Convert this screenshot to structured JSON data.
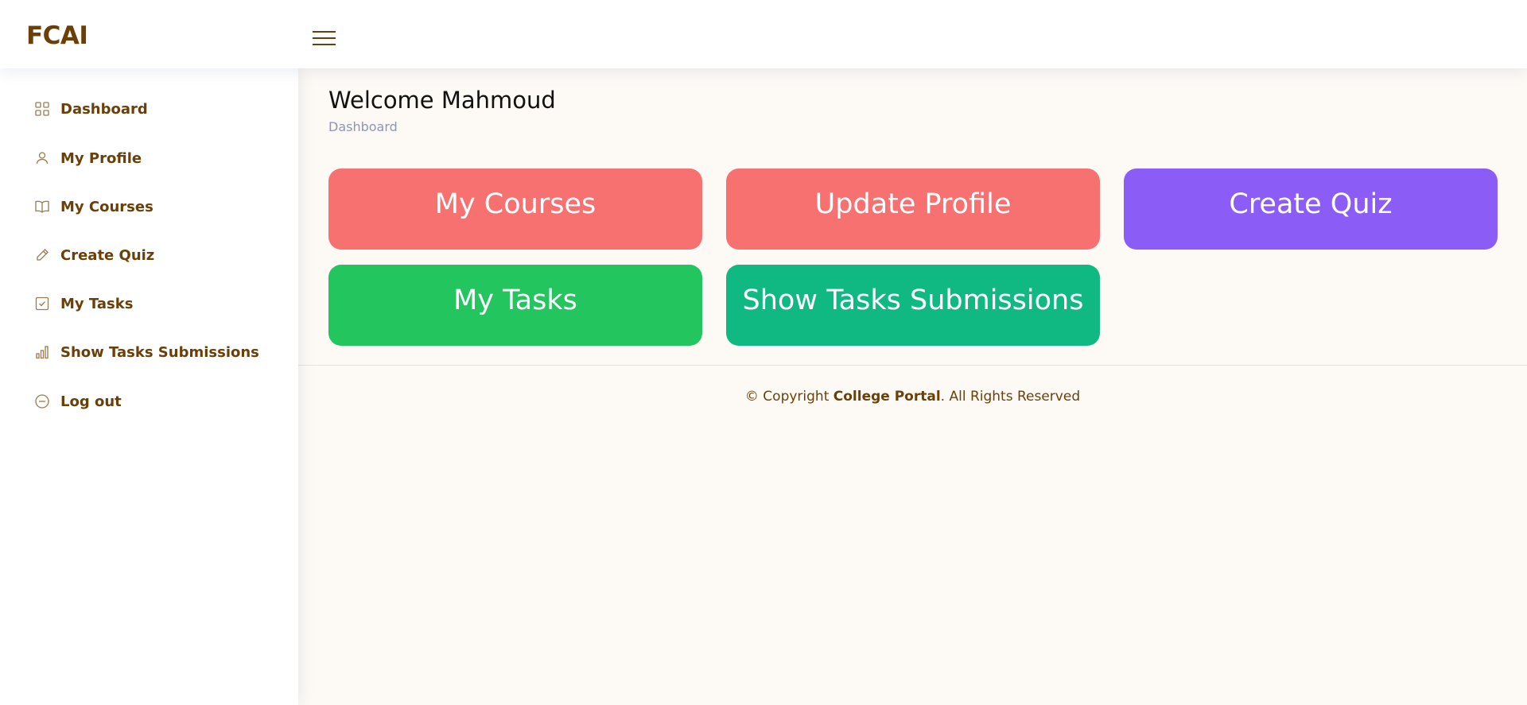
{
  "header": {
    "logo": "FCAI",
    "menu_icon": "hamburger-menu-icon"
  },
  "sidebar": {
    "items": [
      {
        "label": "Dashboard",
        "icon": "grid-icon"
      },
      {
        "label": "My Profile",
        "icon": "person-icon"
      },
      {
        "label": "My Courses",
        "icon": "book-icon"
      },
      {
        "label": "Create Quiz",
        "icon": "pencil-icon"
      },
      {
        "label": "My Tasks",
        "icon": "check-square-icon"
      },
      {
        "label": "Show Tasks Submissions",
        "icon": "bar-chart-icon"
      },
      {
        "label": "Log out",
        "icon": "minus-circle-icon"
      }
    ]
  },
  "main": {
    "title": "Welcome Mahmoud",
    "breadcrumb": "Dashboard",
    "tiles": [
      {
        "label": "My Courses",
        "color": "#f87171"
      },
      {
        "label": "Update Profile",
        "color": "#f87171"
      },
      {
        "label": "Create Quiz",
        "color": "#8b5cf6"
      },
      {
        "label": "My Tasks",
        "color": "#22c55e"
      },
      {
        "label": "Show Tasks Submissions",
        "color": "#10b981"
      }
    ]
  },
  "footer": {
    "prefix": "© Copyright ",
    "brand": "College Portal",
    "suffix": ". All Rights Reserved"
  }
}
